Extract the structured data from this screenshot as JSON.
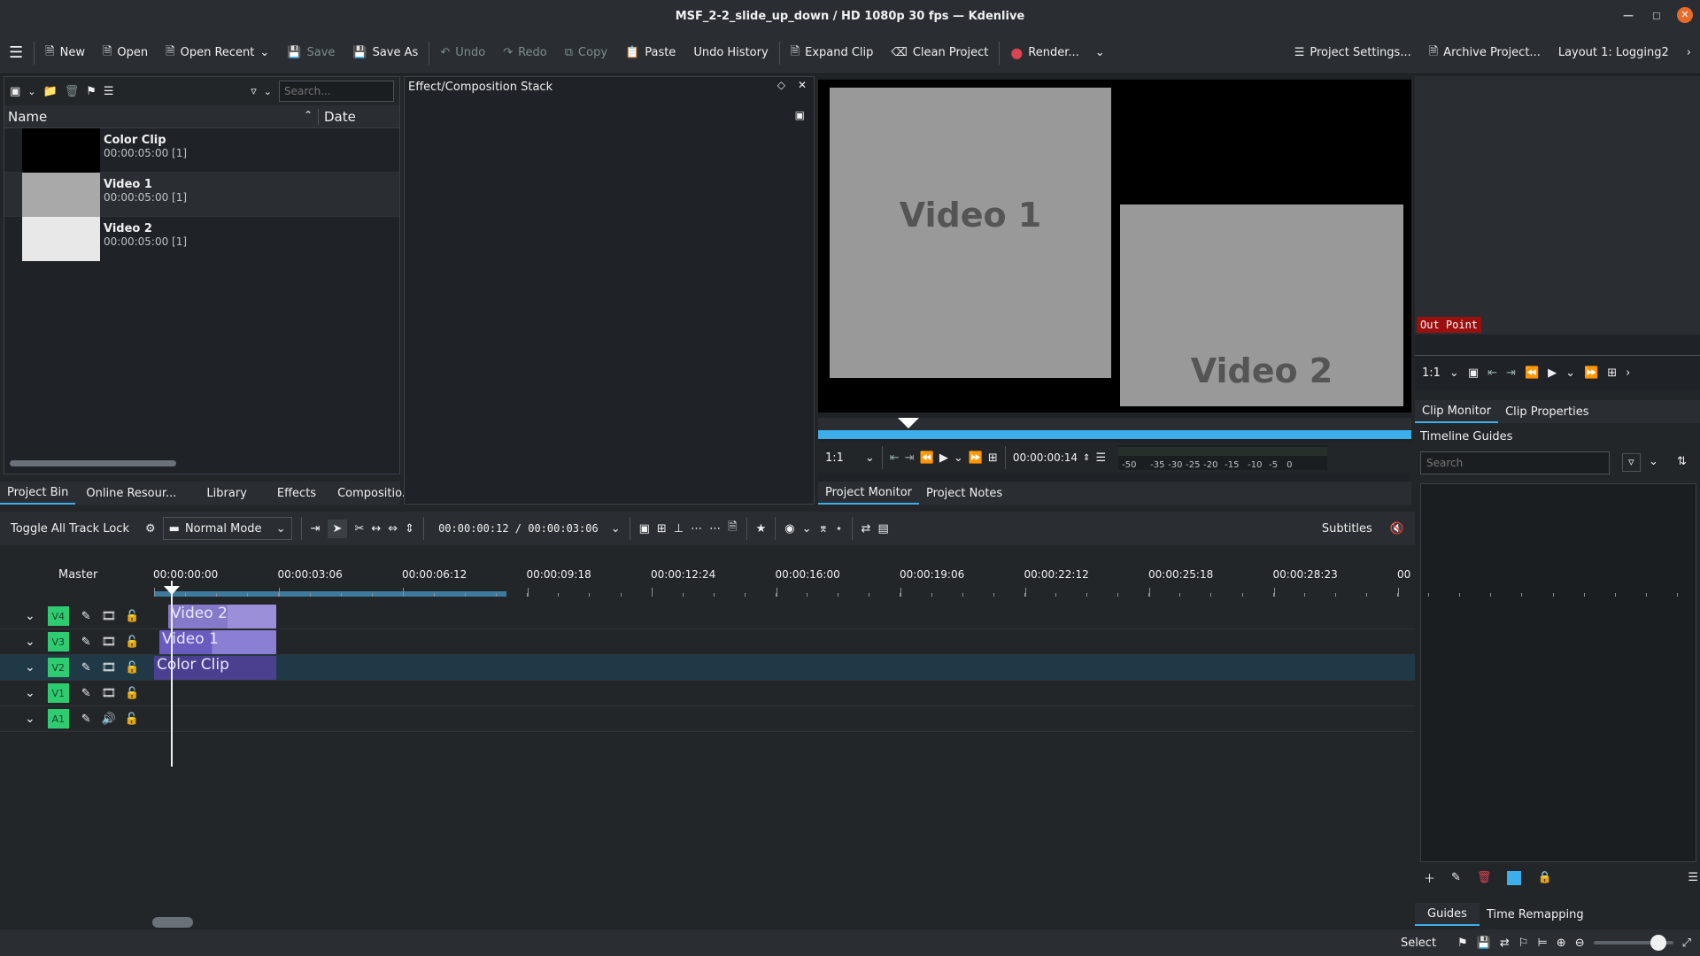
{
  "window": {
    "title": "MSF_2-2_slide_up_down / HD 1080p 30 fps — Kdenlive"
  },
  "toolbar": {
    "new": "New",
    "open": "Open",
    "open_recent": "Open Recent",
    "save": "Save",
    "save_as": "Save As",
    "undo": "Undo",
    "redo": "Redo",
    "copy": "Copy",
    "paste": "Paste",
    "undo_history": "Undo History",
    "expand_clip": "Expand Clip",
    "clean_project": "Clean Project",
    "render": "Render...",
    "project_settings": "Project Settings...",
    "archive_project": "Archive Project...",
    "layout": "Layout 1: Logging2"
  },
  "bin": {
    "search_placeholder": "Search...",
    "col_name": "Name",
    "col_date": "Date",
    "items": [
      {
        "name": "Color Clip",
        "duration": "00:00:05:00 [1]"
      },
      {
        "name": "Video 1",
        "duration": "00:00:05:00 [1]"
      },
      {
        "name": "Video 2",
        "duration": "00:00:05:00 [1]"
      }
    ],
    "tabs": [
      "Project Bin",
      "Online Resour...",
      "Library",
      "Effects",
      "Compositio..."
    ]
  },
  "effect_stack": {
    "title": "Effect/Composition Stack"
  },
  "project_monitor": {
    "frame_label_1": "Video 1",
    "frame_label_2": "Video 2",
    "zoom": "1:1",
    "timecode": "00:00:00:14",
    "meter_labels": [
      "-50",
      "-35",
      "-30",
      "-25",
      "-20",
      "-15",
      "-10",
      "-5",
      "0"
    ],
    "tabs": [
      "Project Monitor",
      "Project Notes"
    ]
  },
  "clip_monitor": {
    "out_point": "Out Point",
    "zoom": "1:1",
    "tabs": [
      "Clip Monitor",
      "Clip Properties"
    ]
  },
  "guides": {
    "title": "Timeline Guides",
    "search_placeholder": "Search",
    "tabs": [
      "Guides",
      "Time Remapping"
    ],
    "color": "#3daee9"
  },
  "timeline_toolbar": {
    "toggle_lock": "Toggle All Track Lock",
    "mode": "Normal Mode",
    "timecode": "00:00:00:12 / 00:00:03:06",
    "subtitles": "Subtitles"
  },
  "timeline": {
    "master": "Master",
    "ruler": [
      "00:00:00:00",
      "00:00:03:06",
      "00:00:06:12",
      "00:00:09:18",
      "00:00:12:24",
      "00:00:16:00",
      "00:00:19:06",
      "00:00:22:12",
      "00:00:25:18",
      "00:00:28:23",
      "00"
    ],
    "tracks": [
      {
        "label": "V4",
        "kind": "video"
      },
      {
        "label": "V3",
        "kind": "video"
      },
      {
        "label": "V2",
        "kind": "video"
      },
      {
        "label": "V1",
        "kind": "video"
      },
      {
        "label": "A1",
        "kind": "audio"
      }
    ],
    "clips": [
      {
        "track": "V4",
        "label": "Video 2"
      },
      {
        "track": "V3",
        "label": "Video 1"
      },
      {
        "track": "V2",
        "label": "Color Clip"
      }
    ]
  },
  "statusbar": {
    "select": "Select"
  }
}
